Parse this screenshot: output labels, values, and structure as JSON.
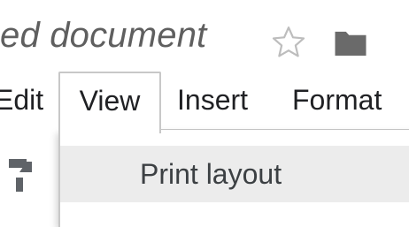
{
  "header": {
    "doc_title": "ed document",
    "icons": [
      "star-icon",
      "folder-icon"
    ]
  },
  "menubar": {
    "items": [
      {
        "label": "Edit"
      },
      {
        "label": "View"
      },
      {
        "label": "Insert"
      },
      {
        "label": "Format"
      }
    ],
    "active": "View"
  },
  "toolbar": {
    "icons": [
      "paint-format-icon"
    ]
  },
  "view_menu": {
    "items": [
      {
        "label": "Print layout"
      }
    ]
  },
  "colors": {
    "title_text": "#5f5f5f",
    "menu_text": "#202124",
    "hover_bg": "#ececec",
    "icon_gray": "#6a6a6a",
    "border": "#c8c8c8"
  }
}
